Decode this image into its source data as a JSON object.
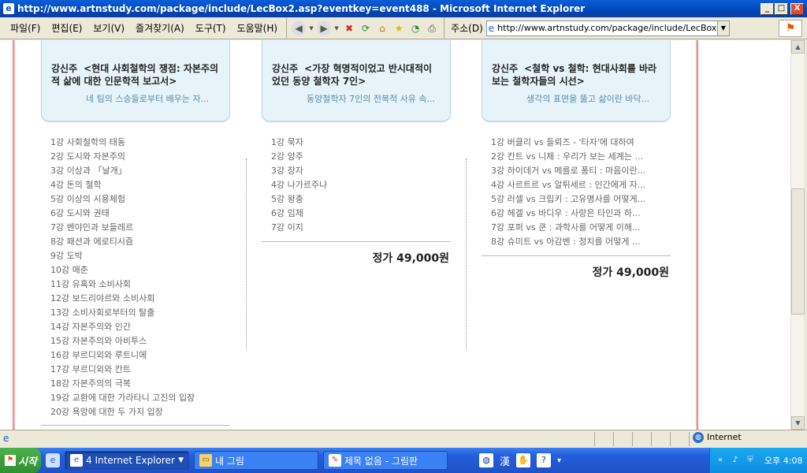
{
  "window": {
    "title": "http://www.artnstudy.com/package/include/LecBox2.asp?eventkey=event488 - Microsoft Internet Explorer",
    "min": "_",
    "max": "□",
    "close": "X"
  },
  "menu": [
    "파일(F)",
    "편집(E)",
    "보기(V)",
    "즐겨찾기(A)",
    "도구(T)",
    "도움말(H)"
  ],
  "address": {
    "label": "주소(D)",
    "value": "http://www.artnstudy.com/package/include/LecBox2"
  },
  "packages": [
    {
      "author": "강신주",
      "title": "<현대 사회철학의 쟁점: 자본주의적 삶에 대한 인문학적 보고서>",
      "subtitle": "네 팀의 스승들로부터 배우는 자...",
      "lessons": [
        "1강 사회철학의 태동",
        "2강 도시와 자본주의",
        "3강 이상과 「날개」",
        "4강 돈의 철학",
        "5강 이상의 시용체험",
        "6강 도시와 권태",
        "7강 벤야민과 보들레르",
        "8강 패션과 에로티시즘",
        "9강 도박",
        "10강 매춘",
        "11강 유혹와 소비사회",
        "12강 보드리야르와 소비사회",
        "13강 소비사회로부터의 탈출",
        "14강 자본주의와 인간",
        "15강 자본주의와 아비투스",
        "16강 부르디외와 루트니에",
        "17강 부르디외와 칸트",
        "18강 자본주의의 극복",
        "19강 교환에 대한 가라타니 고진의 입장",
        "20강 욕망에 대한 두 가지 입장"
      ],
      "price": ""
    },
    {
      "author": "강신주",
      "title": "<가장 혁명적이었고 반시대적이었던 동양 철학자 7인>",
      "subtitle": "동양철학자 7인의 전복적 사유 속...",
      "lessons": [
        "1강 묵자",
        "2강 양주",
        "3강 장자",
        "4강 나가르주나",
        "5강 왕충",
        "6강 임제",
        "7강 이지"
      ],
      "price": "정가 49,000원"
    },
    {
      "author": "강신주",
      "title": "<철학 vs 철학: 현대사회를 바라보는 철학자들의 시선>",
      "subtitle": "생각의 표면을 뚫고 삶이란 바닥...",
      "lessons": [
        "1강 버클리 vs 들뢰즈 - '타자'에 대하여",
        "2강 칸트 vs 니체 : 우리가 보는 세계는 ...",
        "3강 하이데거 vs 메를로 퐁티 : 마음이란...",
        "4강 사르트르 vs 알튀세르 : 인간에게 자...",
        "5강 러셀 vs 크립키 : 고유명사를 어떻게...",
        "6강 헤겔 vs 바디우 : 사랑은 타인과 하...",
        "7강 포퍼 vs 쿤 : 과학사를 어떻게 이해...",
        "8강 슈미트 vs 아감벤 : 정치를 어떻게 ..."
      ],
      "price": "정가 49,000원"
    }
  ],
  "status": {
    "zone": "Internet"
  },
  "taskbar": {
    "start": "시작",
    "tasks": [
      {
        "label": "4 Internet Explorer",
        "active": true
      },
      {
        "label": "내 그림",
        "active": false
      },
      {
        "label": "제목 없음 - 그림판",
        "active": false
      }
    ],
    "lang": "漢",
    "clock": "오후 4:08"
  }
}
